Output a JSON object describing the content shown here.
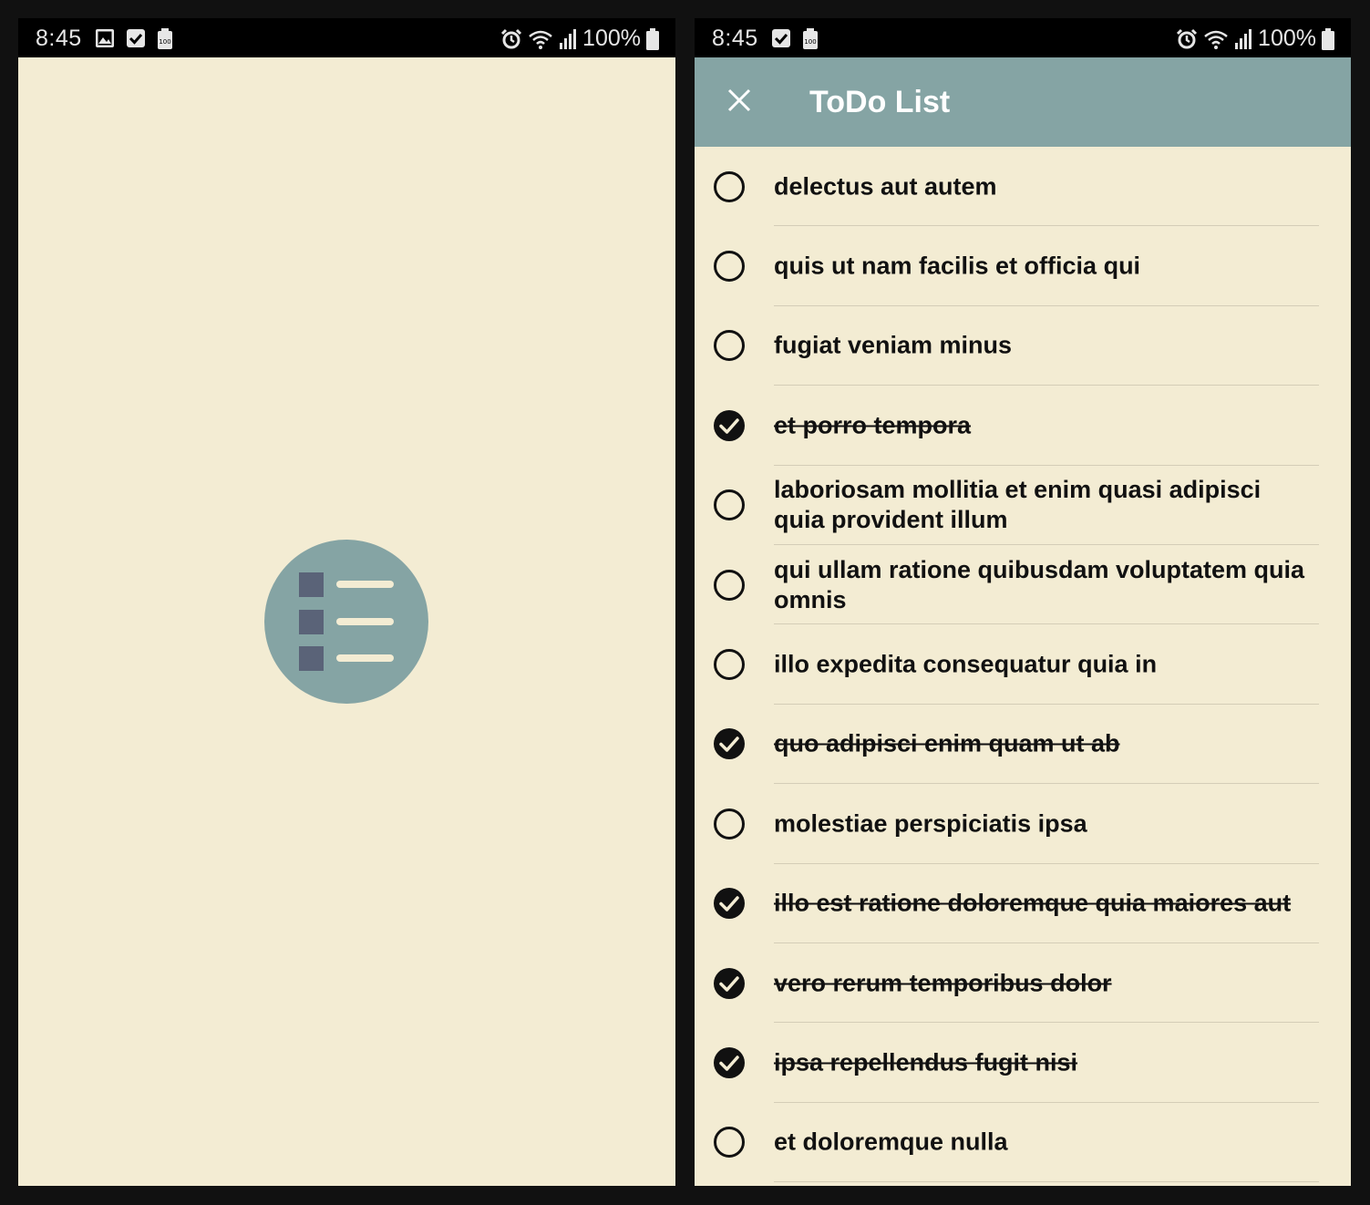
{
  "left_screen": {
    "status_bar": {
      "time": "8:45",
      "icons_left": [
        "image-icon",
        "checkbox-icon",
        "battery-saver-icon"
      ],
      "icons_right": [
        "alarm-icon",
        "wifi-icon",
        "signal-icon"
      ],
      "battery": "100%"
    },
    "splash": {
      "logo": "list-logo-icon",
      "logo_color": "#85a4a4",
      "bullet_color": "#5a6378",
      "line_color": "#f3ecd3"
    }
  },
  "right_screen": {
    "status_bar": {
      "time": "8:45",
      "icons_left": [
        "checkbox-icon",
        "battery-saver-icon"
      ],
      "icons_right": [
        "alarm-icon",
        "wifi-icon",
        "signal-icon"
      ],
      "battery": "100%"
    },
    "app_bar": {
      "title": "ToDo List",
      "close_icon": "close-icon",
      "color": "#85a4a4"
    },
    "todos": [
      {
        "text": "delectus aut autem",
        "done": false
      },
      {
        "text": "quis ut nam facilis et officia qui",
        "done": false
      },
      {
        "text": "fugiat veniam minus",
        "done": false
      },
      {
        "text": "et porro tempora",
        "done": true
      },
      {
        "text": "laboriosam mollitia et enim quasi adipisci quia provident illum",
        "done": false
      },
      {
        "text": "qui ullam ratione quibusdam voluptatem quia omnis",
        "done": false
      },
      {
        "text": "illo expedita consequatur quia in",
        "done": false
      },
      {
        "text": "quo adipisci enim quam ut ab",
        "done": true
      },
      {
        "text": "molestiae perspiciatis ipsa",
        "done": false
      },
      {
        "text": "illo est ratione doloremque quia maiores aut",
        "done": true
      },
      {
        "text": "vero rerum temporibus dolor",
        "done": true
      },
      {
        "text": "ipsa repellendus fugit nisi",
        "done": true
      },
      {
        "text": "et doloremque nulla",
        "done": false
      }
    ]
  },
  "colors": {
    "background": "#f3ecd3",
    "frame": "#111111",
    "status_bar": "#000000",
    "text": "#111111"
  }
}
